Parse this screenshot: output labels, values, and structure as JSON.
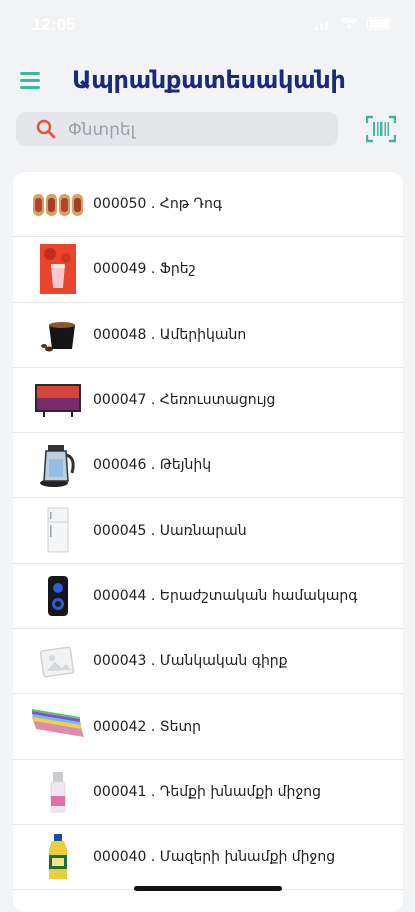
{
  "status_bar": {
    "time": "12:05"
  },
  "header": {
    "title": "Ապրանքատեսականի"
  },
  "search": {
    "placeholder": "Փնտրել"
  },
  "colors": {
    "accent": "#3bb8a0",
    "title": "#1d2a7a",
    "search_icon": "#e0573f"
  },
  "items": [
    {
      "label": "000050 . Հոթ Դոգ",
      "icon": "hot-dog-icon"
    },
    {
      "label": "000049 . Ֆրեշ",
      "icon": "fresh-juice-icon"
    },
    {
      "label": "000048 . Ամերիկանո",
      "icon": "coffee-cup-icon"
    },
    {
      "label": "000047 . Հեռուստացույց",
      "icon": "tv-icon"
    },
    {
      "label": "000046 . Թեյնիկ",
      "icon": "kettle-icon"
    },
    {
      "label": "000045 . Սառնարան",
      "icon": "fridge-icon"
    },
    {
      "label": "000044 . Երաժշտական համակարգ",
      "icon": "speaker-icon"
    },
    {
      "label": "000043 . Մանկական գիրք",
      "icon": "image-placeholder-icon"
    },
    {
      "label": "000042 . Տետր",
      "icon": "notebook-icon"
    },
    {
      "label": "000041 . Դեմքի խնամքի միջոց",
      "icon": "face-care-icon"
    },
    {
      "label": "000040 . Մազերի խնամքի միջոց",
      "icon": "hair-care-icon"
    }
  ]
}
